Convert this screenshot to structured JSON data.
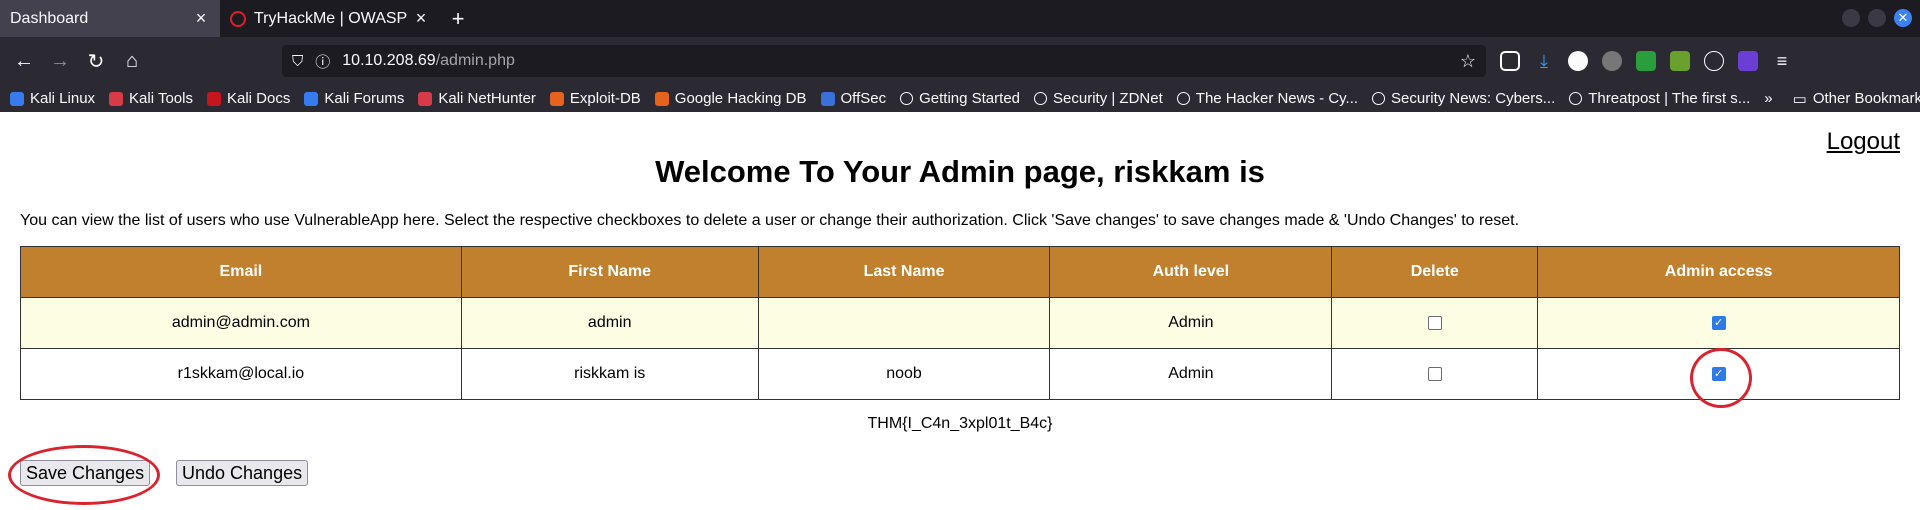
{
  "browser": {
    "tabs": [
      {
        "title": "Dashboard",
        "close": "×"
      },
      {
        "title": "TryHackMe | OWASP Brok",
        "close": "×"
      }
    ],
    "new_tab": "+",
    "url_host": "10.10.208.69",
    "url_path": "/admin.php",
    "bookmarks": [
      "Kali Linux",
      "Kali Tools",
      "Kali Docs",
      "Kali Forums",
      "Kali NetHunter",
      "Exploit-DB",
      "Google Hacking DB",
      "OffSec",
      "Getting Started",
      "Security | ZDNet",
      "The Hacker News - Cy...",
      "Security News: Cybers...",
      "Threatpost | The first s..."
    ],
    "bookmark_overflow": "»",
    "other_bookmarks": "Other Bookmarks"
  },
  "page": {
    "logout": "Logout",
    "heading": "Welcome To Your Admin page, riskkam is",
    "intro": "You can view the list of users who use VulnerableApp here. Select the respective checkboxes to delete a user or change their authorization. Click 'Save changes' to save changes made & 'Undo Changes' to reset.",
    "columns": [
      "Email",
      "First Name",
      "Last Name",
      "Auth level",
      "Delete",
      "Admin access"
    ],
    "rows": [
      {
        "email": "admin@admin.com",
        "first": "admin",
        "last": "",
        "auth": "Admin",
        "delete": false,
        "admin": true
      },
      {
        "email": "r1skkam@local.io",
        "first": "riskkam is",
        "last": "noob",
        "auth": "Admin",
        "delete": false,
        "admin": true
      }
    ],
    "flag": "THM{I_C4n_3xpl01t_B4c}",
    "save_label": "Save Changes",
    "undo_label": "Undo Changes"
  },
  "colors": {
    "header_bg": "#c0802d",
    "annotation": "#d9232e",
    "checkbox_checked": "#2f7ae5"
  }
}
